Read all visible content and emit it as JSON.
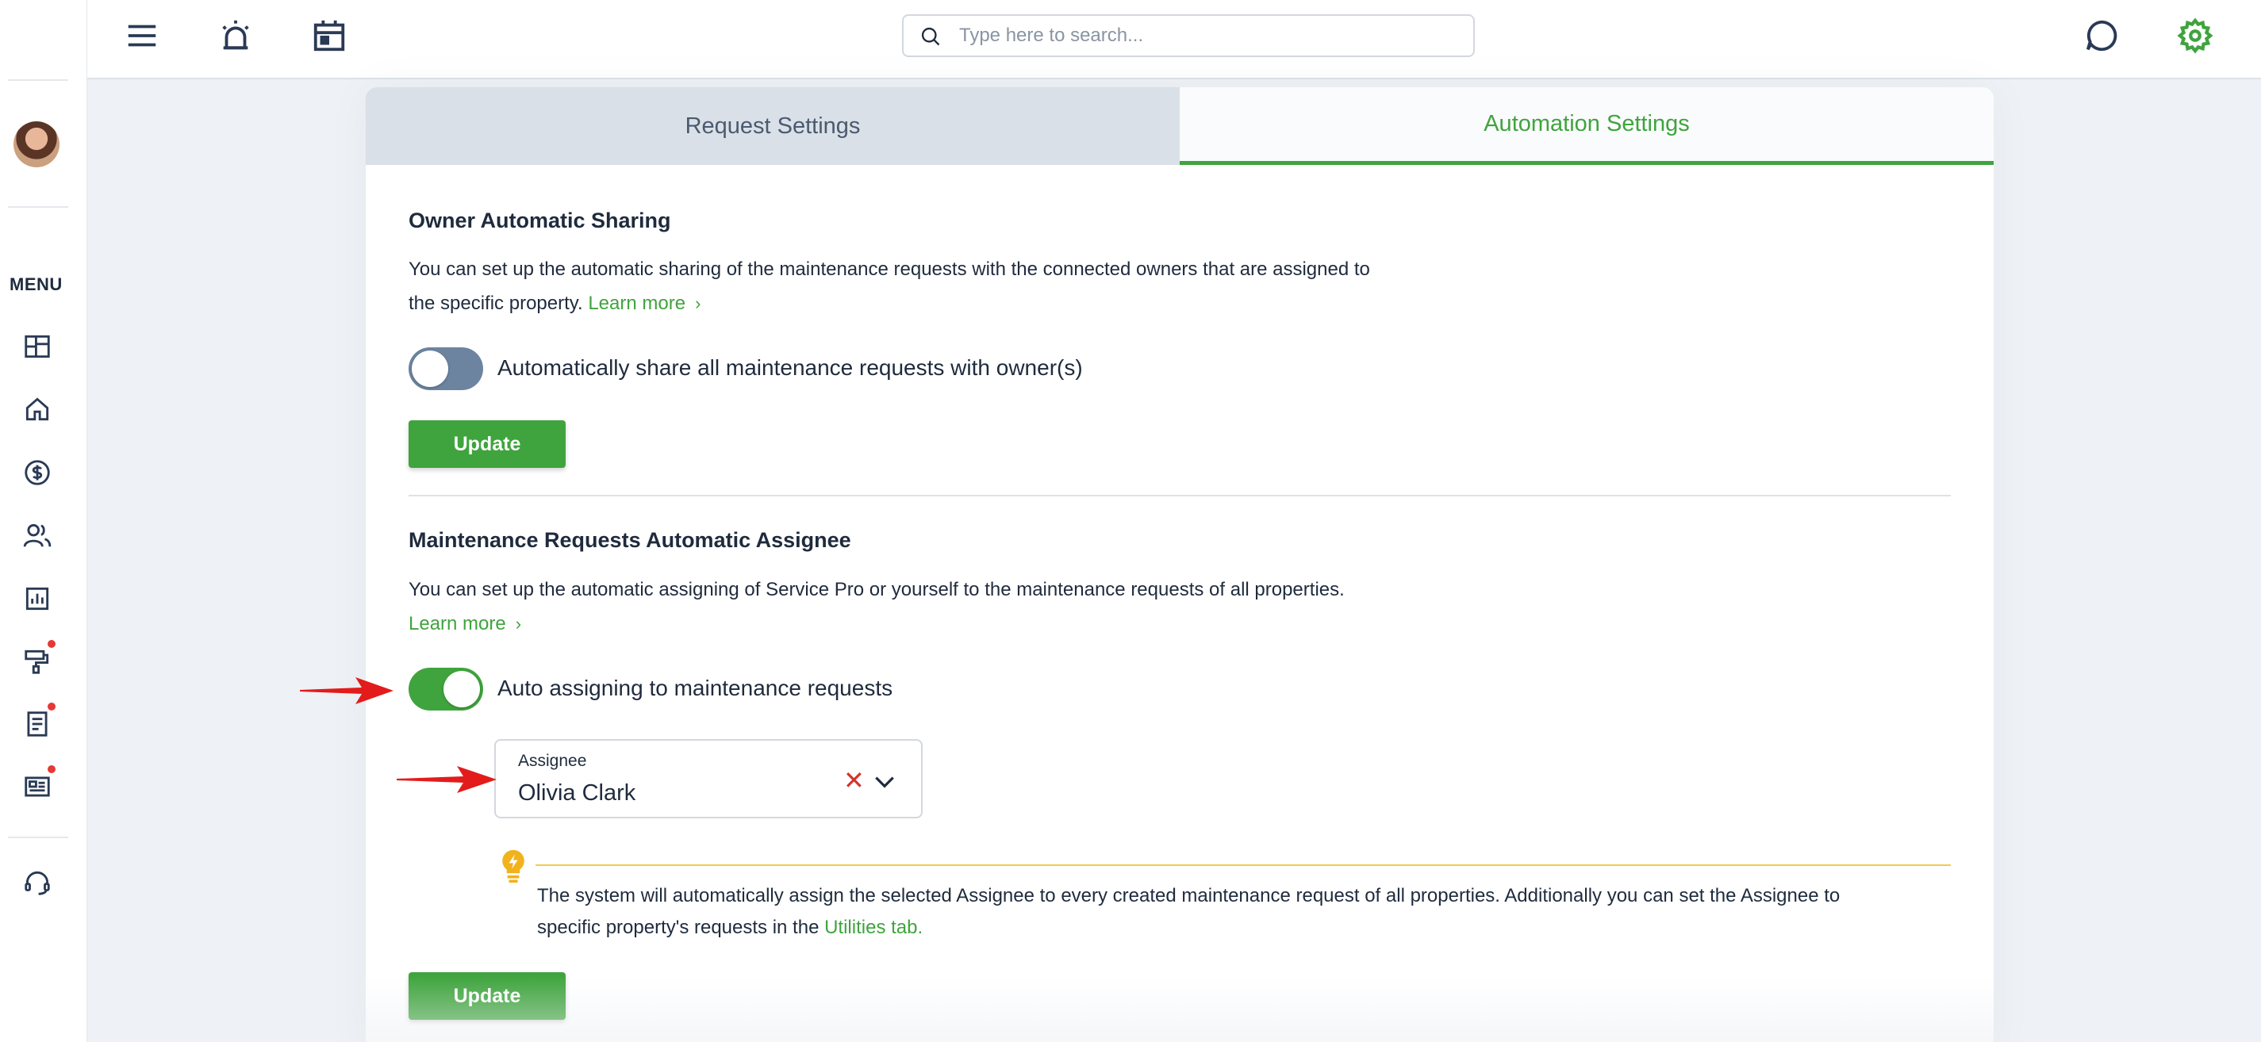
{
  "sidebar": {
    "menu_label": "MENU",
    "items": [
      {
        "icon": "dashboard-icon"
      },
      {
        "icon": "home-icon"
      },
      {
        "icon": "dollar-icon"
      },
      {
        "icon": "users-icon"
      },
      {
        "icon": "reports-icon"
      },
      {
        "icon": "paint-roller-icon",
        "has_notification": true
      },
      {
        "icon": "document-icon",
        "has_notification": true
      },
      {
        "icon": "newspaper-icon",
        "has_notification": true
      }
    ],
    "support_icon": "headset-icon"
  },
  "topbar": {
    "search": {
      "placeholder": "Type here to search..."
    },
    "icons": [
      "menu-icon",
      "alarm-icon",
      "calendar-icon",
      "chat-icon",
      "settings-icon"
    ]
  },
  "tabs": [
    {
      "label": "Request Settings",
      "active": false
    },
    {
      "label": "Automation Settings",
      "active": true
    }
  ],
  "owner_sharing": {
    "title": "Owner Automatic Sharing",
    "description_line1": "You can set up the automatic sharing of the maintenance requests with the connected owners that are assigned to",
    "description_line2": "the specific property.",
    "learn_more": "Learn more",
    "toggle_label": "Automatically share all maintenance requests with owner(s)",
    "toggle_on": false,
    "update_label": "Update"
  },
  "auto_assignee": {
    "title": "Maintenance Requests Automatic Assignee",
    "description": "You can set up the automatic assigning of Service Pro or yourself to the maintenance requests of all properties.",
    "learn_more": "Learn more",
    "toggle_label": "Auto assigning to maintenance requests",
    "toggle_on": true,
    "assignee_label": "Assignee",
    "assignee_value": "Olivia Clark",
    "tip_line1": "The system will automatically assign the selected Assignee to every created maintenance request of all properties. Additionally you can set the Assignee to",
    "tip_line2": "specific property's requests in the",
    "tip_link": "Utilities tab.",
    "update_label": "Update"
  },
  "colors": {
    "accent": "#3fa43d",
    "toggle_off": "#6c84a0",
    "annotation_arrow": "#e31b1b",
    "tip_accent": "#f2c94c"
  }
}
